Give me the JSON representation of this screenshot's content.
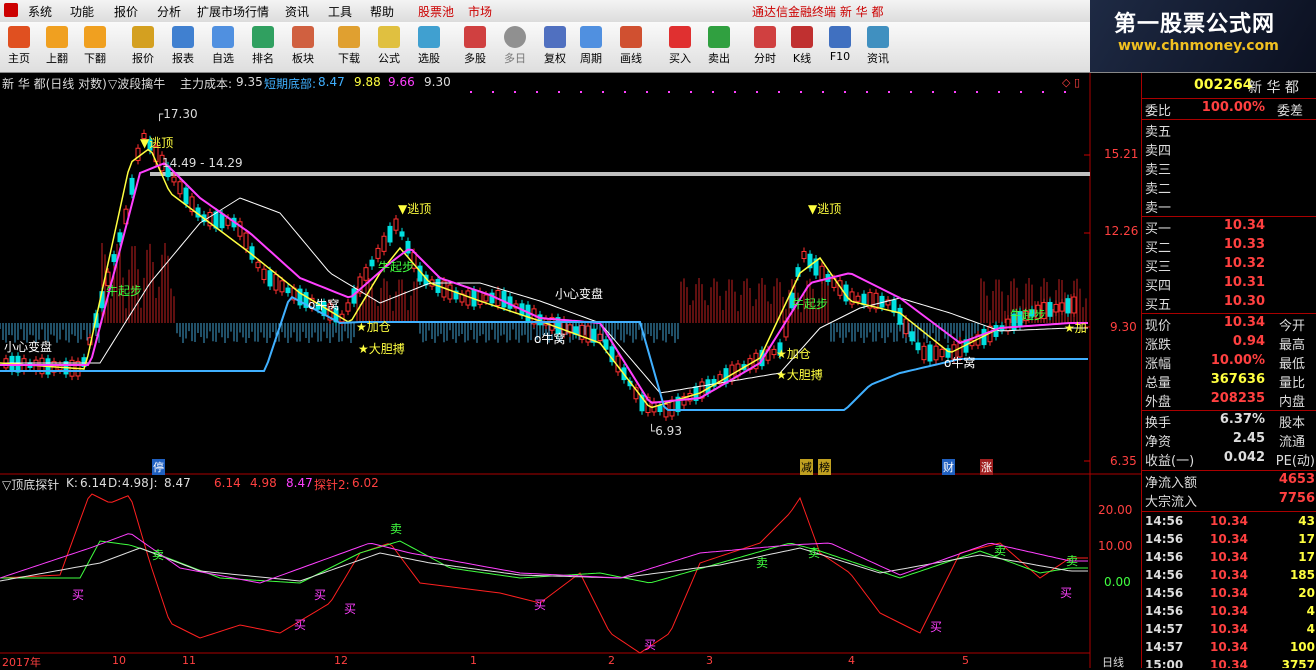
{
  "menubar": {
    "items": [
      "系统",
      "功能",
      "报价",
      "分析",
      "扩展市场行情",
      "资讯",
      "工具",
      "帮助",
      "股票池",
      "市场"
    ],
    "title": "通达信金融终端 新 华 都"
  },
  "toolbar": {
    "buttons": [
      "主页",
      "上翻",
      "下翻",
      "报价",
      "报表",
      "自选",
      "排名",
      "板块",
      "下载",
      "公式",
      "选股",
      "多股",
      "多日",
      "复权",
      "周期",
      "画线",
      "买入",
      "卖出",
      "分时",
      "K线",
      "F10",
      "资讯"
    ]
  },
  "banner": {
    "line1": "第一股票公式网",
    "line2": "www.chnmoney.com"
  },
  "main_chart": {
    "header_name": "新 华 都(日线 对数)",
    "indicator": "▽波段擒牛",
    "cost_label": "主力成本:",
    "cost_value": "9.35",
    "bottom_label": "短期底部:",
    "bottom_values": [
      "8.47",
      "9.88",
      "9.66",
      "9.30"
    ],
    "y_axis": [
      "15.21",
      "12.26",
      "9.30",
      "6.35"
    ],
    "annotations": {
      "high": "17.30",
      "range": "14.49 - 14.29",
      "low": "6.93",
      "escape": "▼逃顶",
      "bull_start": "牛起步",
      "add": "★加仓",
      "bold": "★大胆搏",
      "careful": "小心变盘",
      "nest": "o牛窝",
      "add_short": "★加"
    },
    "markers": [
      "停",
      "减",
      "榜",
      "财",
      "涨"
    ]
  },
  "lower_chart": {
    "title": "▽顶底探针",
    "k_label": "K:",
    "k": "6.14",
    "d_label": "D:",
    "d": "4.98",
    "j_label": "J:",
    "j": "8.47",
    "values": [
      "6.14",
      "4.98",
      "8.47"
    ],
    "probe_label": "探针2:",
    "probe": "6.02",
    "y_axis": [
      "20.00",
      "10.00",
      "0.00"
    ],
    "buy": "买",
    "sell": "卖"
  },
  "x_axis": {
    "labels": [
      "2017年",
      "10",
      "11",
      "12",
      "1",
      "2",
      "3",
      "4",
      "5"
    ],
    "period": "日线"
  },
  "right_panel": {
    "code": "002264",
    "name": "新 华 都",
    "weibi_label": "委比",
    "weibi": "100.00%",
    "weicha_label": "委差",
    "asks": [
      {
        "label": "卖五",
        "price": ""
      },
      {
        "label": "卖四",
        "price": ""
      },
      {
        "label": "卖三",
        "price": ""
      },
      {
        "label": "卖二",
        "price": ""
      },
      {
        "label": "卖一",
        "price": ""
      }
    ],
    "bids": [
      {
        "label": "买一",
        "price": "10.34"
      },
      {
        "label": "买二",
        "price": "10.33"
      },
      {
        "label": "买三",
        "price": "10.32"
      },
      {
        "label": "买四",
        "price": "10.31"
      },
      {
        "label": "买五",
        "price": "10.30"
      }
    ],
    "stats": [
      {
        "label": "现价",
        "value": "10.34",
        "color": "#ff4040",
        "right": "今开"
      },
      {
        "label": "涨跌",
        "value": "0.94",
        "color": "#ff4040",
        "right": "最高"
      },
      {
        "label": "涨幅",
        "value": "10.00%",
        "color": "#ff4040",
        "right": "最低"
      },
      {
        "label": "总量",
        "value": "367636",
        "color": "#ffff40",
        "right": "量比"
      },
      {
        "label": "外盘",
        "value": "208235",
        "color": "#ff4040",
        "right": "内盘"
      },
      {
        "label": "换手",
        "value": "6.37%",
        "color": "#ddd",
        "right": "股本"
      },
      {
        "label": "净资",
        "value": "2.45",
        "color": "#ddd",
        "right": "流通"
      },
      {
        "label": "收益(一)",
        "value": "0.042",
        "color": "#ddd",
        "right": "PE(动)"
      }
    ],
    "flow": [
      {
        "label": "净流入额",
        "value": "4653"
      },
      {
        "label": "大宗流入",
        "value": "7756"
      }
    ],
    "ticks": [
      {
        "time": "14:56",
        "price": "10.34",
        "vol": "43"
      },
      {
        "time": "14:56",
        "price": "10.34",
        "vol": "17"
      },
      {
        "time": "14:56",
        "price": "10.34",
        "vol": "17"
      },
      {
        "time": "14:56",
        "price": "10.34",
        "vol": "185"
      },
      {
        "time": "14:56",
        "price": "10.34",
        "vol": "20"
      },
      {
        "time": "14:56",
        "price": "10.34",
        "vol": "4"
      },
      {
        "time": "14:57",
        "price": "10.34",
        "vol": "4"
      },
      {
        "time": "14:57",
        "price": "10.34",
        "vol": "100"
      },
      {
        "time": "15:00",
        "price": "10.34",
        "vol": "3757"
      }
    ]
  },
  "colors": {
    "up": "#ff3030",
    "down": "#00e0e0",
    "ma_white": "#ffffff",
    "ma_yellow": "#ffff40",
    "ma_magenta": "#ff40ff",
    "support": "#40b0ff"
  }
}
